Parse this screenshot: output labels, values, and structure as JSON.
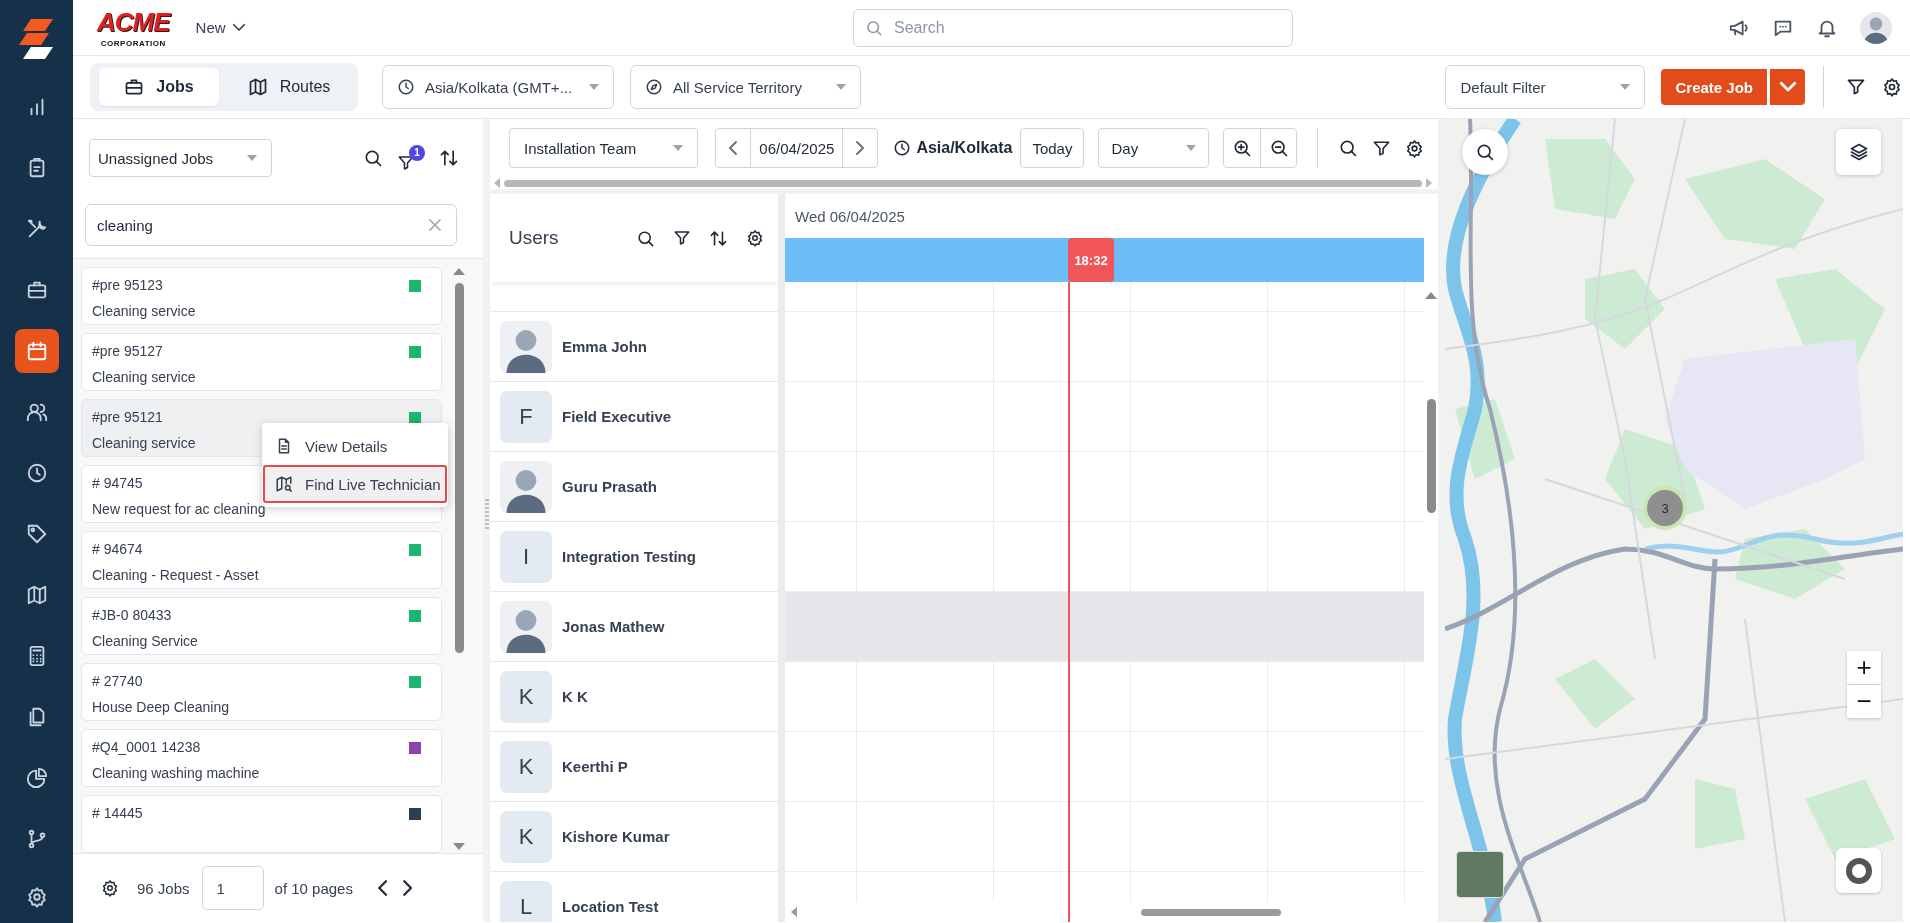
{
  "nav": {
    "items": [
      {
        "kind": "chart",
        "selected": false
      },
      {
        "kind": "clipboard",
        "selected": false
      },
      {
        "kind": "tools",
        "selected": false
      },
      {
        "kind": "briefcase",
        "selected": false
      },
      {
        "kind": "calendar",
        "selected": true
      },
      {
        "kind": "users",
        "selected": false
      },
      {
        "kind": "clock",
        "selected": false
      },
      {
        "kind": "tag",
        "selected": false
      },
      {
        "kind": "map",
        "selected": false
      },
      {
        "kind": "calculator",
        "selected": false
      },
      {
        "kind": "documents",
        "selected": false
      },
      {
        "kind": "pie",
        "selected": false
      },
      {
        "kind": "branch",
        "selected": false
      },
      {
        "kind": "settings",
        "selected": false
      }
    ]
  },
  "topbar": {
    "logo": "ACME",
    "logo_sub": "CORPORATION",
    "new_menu": "New",
    "search": {
      "placeholder": "Search"
    }
  },
  "toolbar": {
    "tabs": [
      {
        "label": "Jobs",
        "kind": "briefcase",
        "selected": true
      },
      {
        "label": "Routes",
        "kind": "map",
        "selected": false
      }
    ],
    "timezone": "Asia/Kolkata (GMT+...",
    "territory": "All Service Territory",
    "filter": "Default Filter",
    "create_button": "Create Job"
  },
  "jobs_panel": {
    "view": "Unassigned Jobs",
    "filter_badge": "1",
    "search": {
      "value": "cleaning"
    },
    "jobs": [
      {
        "number": "#pre 95123",
        "title": "Cleaning service",
        "color": "#1db66e",
        "hovered": false
      },
      {
        "number": "#pre 95127",
        "title": "Cleaning service",
        "color": "#1db66e",
        "hovered": false
      },
      {
        "number": "#pre 95121",
        "title": "Cleaning service",
        "color": "#1db66e",
        "hovered": true
      },
      {
        "number": "# 94745",
        "title": "New request for ac cleaning",
        "hovered": false
      },
      {
        "number": "# 94674",
        "title": "Cleaning - Request - Asset",
        "color": "#1db66e",
        "hovered": false
      },
      {
        "number": "#JB-0 80433",
        "title": "Cleaning Service",
        "color": "#1db66e",
        "hovered": false
      },
      {
        "number": "# 27740",
        "title": "House Deep Cleaning",
        "color": "#1db66e",
        "hovered": false
      },
      {
        "number": "#Q4_0001 14238",
        "title": "Cleaning washing machine",
        "color": "#8e44ad",
        "hovered": false
      },
      {
        "number": "# 14445",
        "color": "#2c3e50",
        "hovered": false
      }
    ],
    "context_menu": {
      "items": [
        {
          "label": "View Details",
          "kind": "details",
          "highlighted": false
        },
        {
          "label": "Find Live Technician",
          "kind": "map",
          "highlighted": true
        }
      ]
    },
    "footer": {
      "count": "96 Jobs",
      "page": "1",
      "of_pages": "of 10 pages"
    }
  },
  "schedule": {
    "team": "Installation Team",
    "date": "06/04/2025",
    "timezone": "Asia/Kolkata",
    "today": "Today",
    "view": "Day",
    "users_title": "Users",
    "day_header": "Wed 06/04/2025",
    "now": "18:32",
    "users": [
      {
        "name": "Emma John",
        "kind": "photo",
        "shaded": false
      },
      {
        "name": "Field Executive",
        "kind": "initial",
        "initial": "F",
        "shaded": false
      },
      {
        "name": "Guru Prasath",
        "kind": "photo",
        "shaded": false
      },
      {
        "name": "Integration Testing",
        "kind": "initial",
        "initial": "I",
        "shaded": false
      },
      {
        "name": "Jonas Mathew",
        "kind": "photo",
        "shaded": true
      },
      {
        "name": "K K",
        "kind": "initial",
        "initial": "K",
        "shaded": false
      },
      {
        "name": "Keerthi P",
        "kind": "initial",
        "initial": "K",
        "shaded": false
      },
      {
        "name": "Kishore Kumar",
        "kind": "initial",
        "initial": "K",
        "shaded": false
      },
      {
        "name": "Location Test",
        "kind": "initial",
        "initial": "L",
        "shaded": false
      }
    ]
  },
  "map": {
    "cluster": "3",
    "zoom_in": "+",
    "zoom_out": "−"
  }
}
